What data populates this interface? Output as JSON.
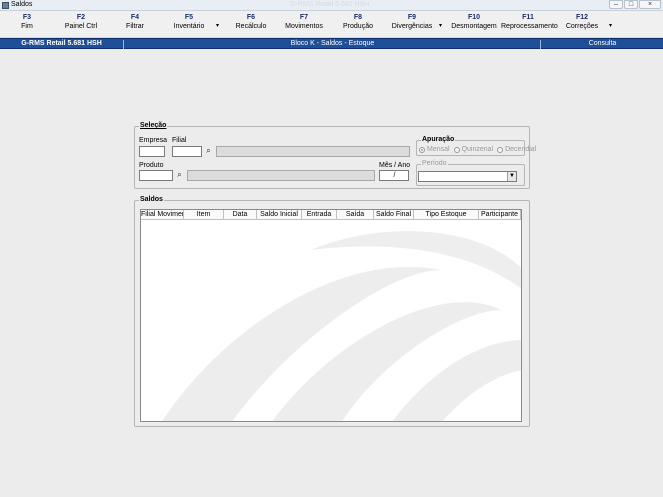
{
  "window": {
    "title": "Saldos",
    "ghost_title": "G-RMS Retail 5.681 HSH"
  },
  "toolbar": [
    {
      "key": "F3",
      "label": "Fim"
    },
    {
      "key": "F2",
      "label": "Painel Ctrl"
    },
    {
      "key": "F4",
      "label": "Filtrar"
    },
    {
      "key": "F5",
      "label": "Inventário"
    },
    {
      "key": "F6",
      "label": "Recálculo"
    },
    {
      "key": "F7",
      "label": "Movimentos"
    },
    {
      "key": "F8",
      "label": "Produção"
    },
    {
      "key": "F9",
      "label": "Divergências"
    },
    {
      "key": "F10",
      "label": "Desmontagem"
    },
    {
      "key": "F11",
      "label": "Reprocessamento"
    },
    {
      "key": "F12",
      "label": "Correções"
    }
  ],
  "toolbar_caret": "▾",
  "statusbar": {
    "version": "G-RMS Retail 5.681 HSH",
    "screen": "Bloco K - Saldos - Estoque",
    "mode": "Consulta"
  },
  "selecao": {
    "title": "Seleção",
    "empresa_label": "Empresa",
    "filial_label": "Filial",
    "produto_label": "Produto",
    "mes_ano_label": "Mês / Ano",
    "mes_ano_value": "/",
    "empresa_value": "",
    "filial_value": "",
    "produto_value": "",
    "apuracao": {
      "title": "Apuração",
      "options": [
        {
          "label": "Mensal",
          "selected": true
        },
        {
          "label": "Quinzenal",
          "selected": false
        },
        {
          "label": "Decendial",
          "selected": false
        }
      ]
    },
    "periodo": {
      "title": "Período",
      "value": ""
    }
  },
  "saldos": {
    "title": "Saldos",
    "columns": [
      "Filial Movimento",
      "Item",
      "Data",
      "Saldo Inicial",
      "Entrada",
      "Saída",
      "Saldo Final",
      "Tipo Estoque",
      "Participante"
    ],
    "rows": []
  },
  "icons": {
    "search": "binoculars-icon",
    "dropdown": "chevron-down-icon"
  }
}
